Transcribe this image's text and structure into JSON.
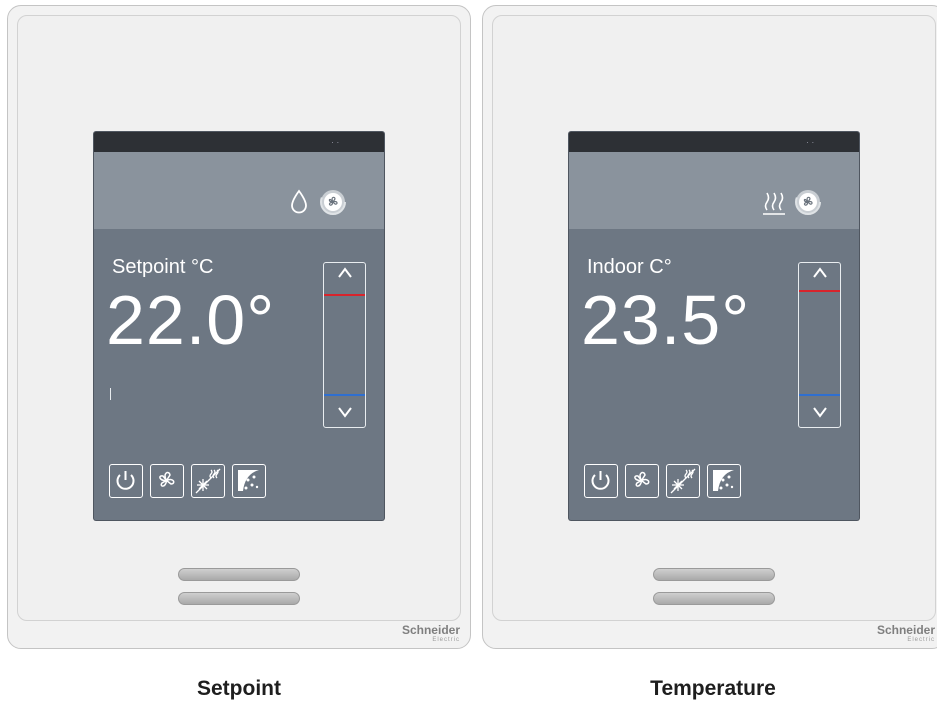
{
  "brand": {
    "line1": "Schneider",
    "line2": "Electric"
  },
  "thermostats": [
    {
      "screen_label": "Setpoint °C",
      "screen_value": "22.0°",
      "status_icons": [
        "water-drop-icon",
        "fan-status-icon"
      ],
      "modes": [
        "power-icon",
        "fan-icon",
        "heat-cool-icon",
        "schedule-icon"
      ],
      "caption": "Setpoint"
    },
    {
      "screen_label": "Indoor C°",
      "screen_value": "23.5°",
      "status_icons": [
        "heating-icon",
        "fan-status-icon"
      ],
      "modes": [
        "power-icon",
        "fan-icon",
        "heat-cool-icon",
        "schedule-icon"
      ],
      "caption": "Temperature"
    }
  ],
  "colors": {
    "screen": "#6d7783",
    "status_band": "#8a939d",
    "heat_limit": "#d8242c",
    "cool_limit": "#2f6fd0"
  }
}
